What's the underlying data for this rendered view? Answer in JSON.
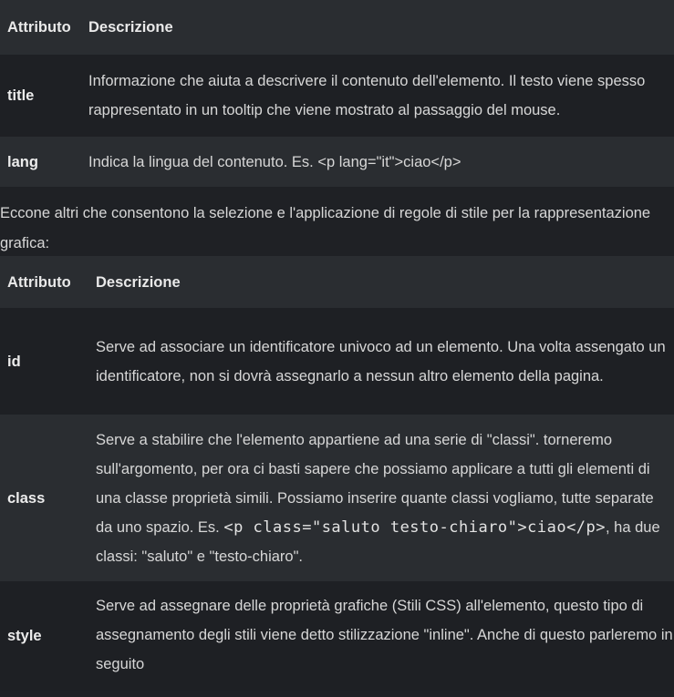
{
  "table1": {
    "headers": {
      "attribute": "Attributo",
      "description": "Descrizione"
    },
    "rows": [
      {
        "attribute": "title",
        "description": "Informazione che aiuta a descrivere il contenuto dell'elemento. Il testo viene spesso rappresentato in un tooltip che viene mostrato al passaggio del mouse."
      },
      {
        "attribute": "lang",
        "description": "Indica la lingua del contenuto. Es. <p lang=\"it\">ciao</p>"
      }
    ]
  },
  "intro_text": "Eccone altri che consentono la selezione e l'applicazione di regole di stile per la rappresentazione grafica:",
  "table2": {
    "headers": {
      "attribute": "Attributo",
      "description": "Descrizione"
    },
    "rows": [
      {
        "attribute": "id",
        "description": "Serve ad associare un identificatore univoco ad un elemento. Una volta assengato un identificatore, non si dovrà assegnarlo a nessun altro elemento della pagina."
      },
      {
        "attribute": "class",
        "description_before": "Serve a stabilire che l'elemento appartiene ad una serie di \"classi\". torneremo sull'argomento, per ora ci basti sapere che possiamo applicare a tutti gli elementi di una classe proprietà simili. Possiamo inserire quante classi vogliamo, tutte separate da uno spazio. Es. ",
        "description_code": "<p class=\"saluto testo-chiaro\">ciao</p>",
        "description_after": ", ha due classi: \"saluto\" e \"testo-chiaro\"."
      },
      {
        "attribute": "style",
        "description": "Serve ad assegnare delle proprietà grafiche (Stili CSS) all'elemento, questo tipo di assegnamento degli stili viene detto stilizzazione \"inline\". Anche di questo parleremo in seguito"
      }
    ]
  }
}
